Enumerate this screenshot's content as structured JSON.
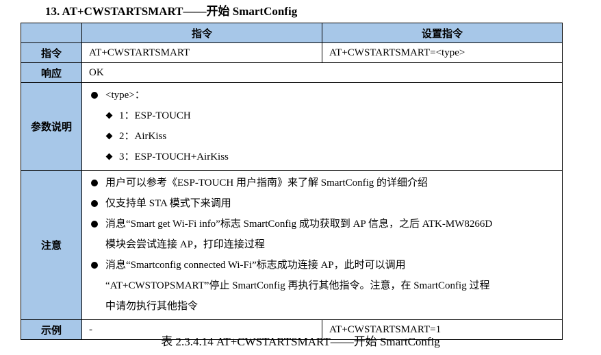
{
  "section_title": "13. AT+CWSTARTSMART——开始 SmartConfig",
  "table": {
    "header": {
      "col_cmd": "指令",
      "col_set": "设置指令"
    },
    "rows": {
      "command": {
        "label": "指令",
        "cmd": "AT+CWSTARTSMART",
        "set": "AT+CWSTARTSMART=<type>"
      },
      "response": {
        "label": "响应",
        "value": "OK"
      },
      "params": {
        "label": "参数说明",
        "bullet": "<type>：",
        "items": [
          "1：ESP-TOUCH",
          "2：AirKiss",
          "3：ESP-TOUCH+AirKiss"
        ]
      },
      "notes": {
        "label": "注意",
        "n1": "用户可以参考《ESP-TOUCH 用户指南》来了解 SmartConfig 的详细介绍",
        "n2": "仅支持单 STA 模式下来调用",
        "n3_l1": "消息“Smart get Wi-Fi info”标志 SmartConfig 成功获取到 AP 信息，之后 ATK-MW8266D",
        "n3_l2": "模块会尝试连接 AP，打印连接过程",
        "n4_l1": "消息“Smartconfig connected Wi-Fi”标志成功连接 AP，此时可以调用",
        "n4_l2": "“AT+CWSTOPSMART”停止 SmartConfig 再执行其他指令。注意，在 SmartConfig 过程",
        "n4_l3": "中请勿执行其他指令"
      },
      "example": {
        "label": "示例",
        "cmd": "-",
        "set": "AT+CWSTARTSMART=1"
      }
    }
  },
  "caption": "表 2.3.4.14 AT+CWSTARTSMART——开始 SmartConfig",
  "colors": {
    "header_bg": "#a7c7e8"
  }
}
